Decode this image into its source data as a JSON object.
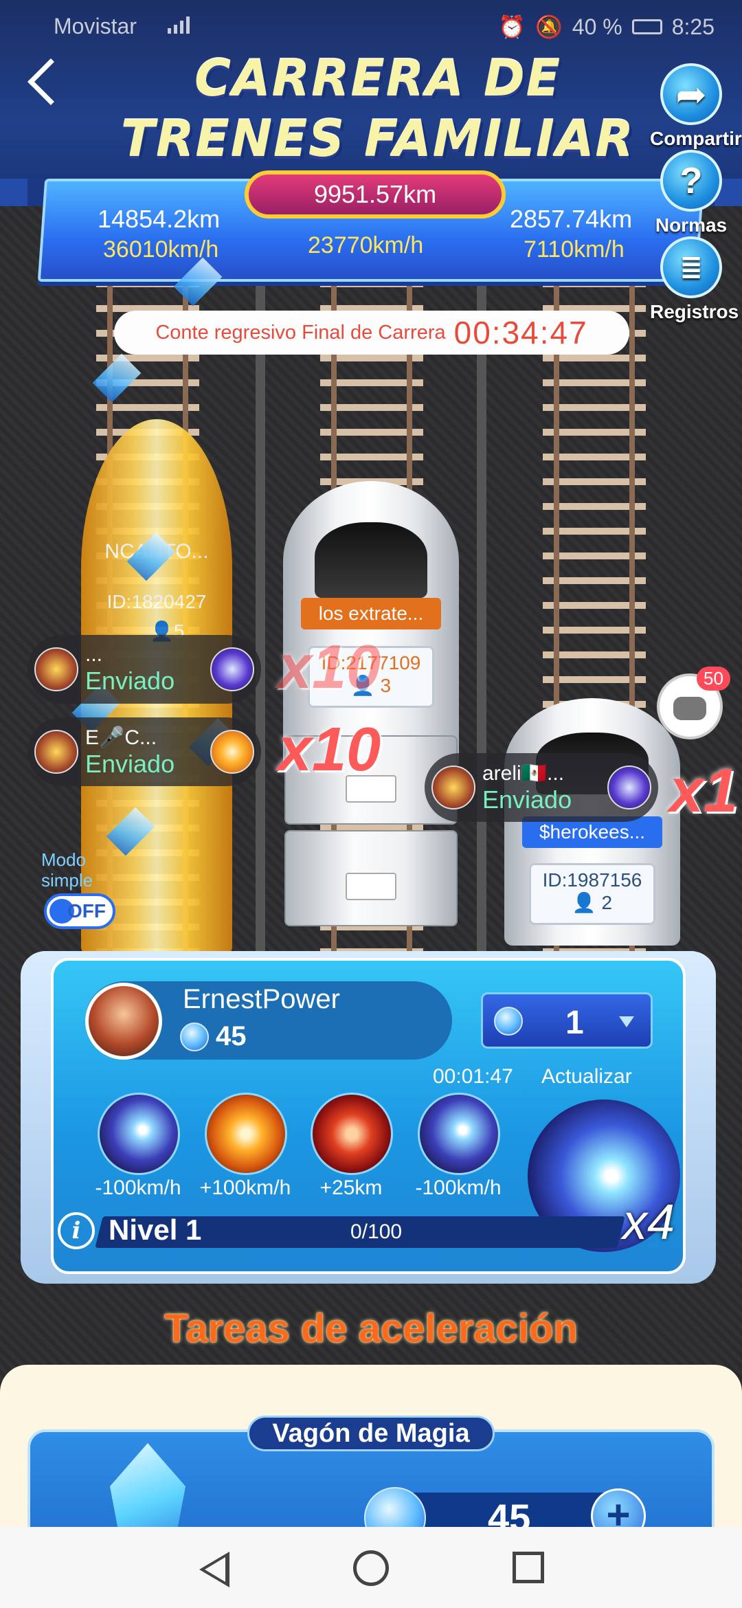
{
  "status_bar": {
    "carrier": "Movistar",
    "battery": "40 %",
    "time": "8:25"
  },
  "header": {
    "title_line1": "CARRERA DE",
    "title_line2": "TRENES FAMILIAR"
  },
  "side_buttons": {
    "share": "Compartir",
    "rules": "Normas",
    "records": "Registros"
  },
  "race": {
    "total_distance": "9951.57km",
    "left": {
      "distance": "14854.2km",
      "speed": "36010km/h"
    },
    "center": {
      "speed": "23770km/h"
    },
    "right": {
      "distance": "2857.74km",
      "speed": "7110km/h"
    },
    "countdown_label": "Conte   regresivo Final de Carrera",
    "countdown_time": "00:34:47"
  },
  "trains": [
    {
      "name": "NCANTO...",
      "id": "ID:1820427",
      "members": "5"
    },
    {
      "name": "los extrate...",
      "id": "ID:2177109",
      "members": "3"
    },
    {
      "name": "$herokees...",
      "id": "ID:1987156",
      "members": "2"
    }
  ],
  "sent_bubbles": [
    {
      "name": "...",
      "status": "Enviado"
    },
    {
      "name": "E🎤C...",
      "status": "Enviado"
    },
    {
      "name": "areli🇲🇽...",
      "status": "Enviado"
    }
  ],
  "multipliers": [
    "x10",
    "x10",
    "x1"
  ],
  "chat_badge": "50",
  "modo_simple": {
    "label_line1": "Modo",
    "label_line2": "simple",
    "toggle": "OFF"
  },
  "panel": {
    "user_name": "ErnestPower",
    "gems": "45",
    "selected_qty": "1",
    "timer": "00:01:47",
    "refresh": "Actualizar",
    "boosts": [
      "-100km/h",
      "+100km/h",
      "+25km",
      "-100km/h"
    ],
    "big_multiplier": "x4",
    "info_icon": "i",
    "level": "Nivel 1",
    "progress": "0/100"
  },
  "tasks_title": "Tareas de aceleración",
  "magic": {
    "title": "Vagón de Magia",
    "qty": "45",
    "plus": "+"
  },
  "colors": {
    "accent_blue": "#1c97e3",
    "countdown_red": "#e74b3c",
    "tasks_orange": "#ff6a1a",
    "sent_green": "#7af0c0"
  }
}
